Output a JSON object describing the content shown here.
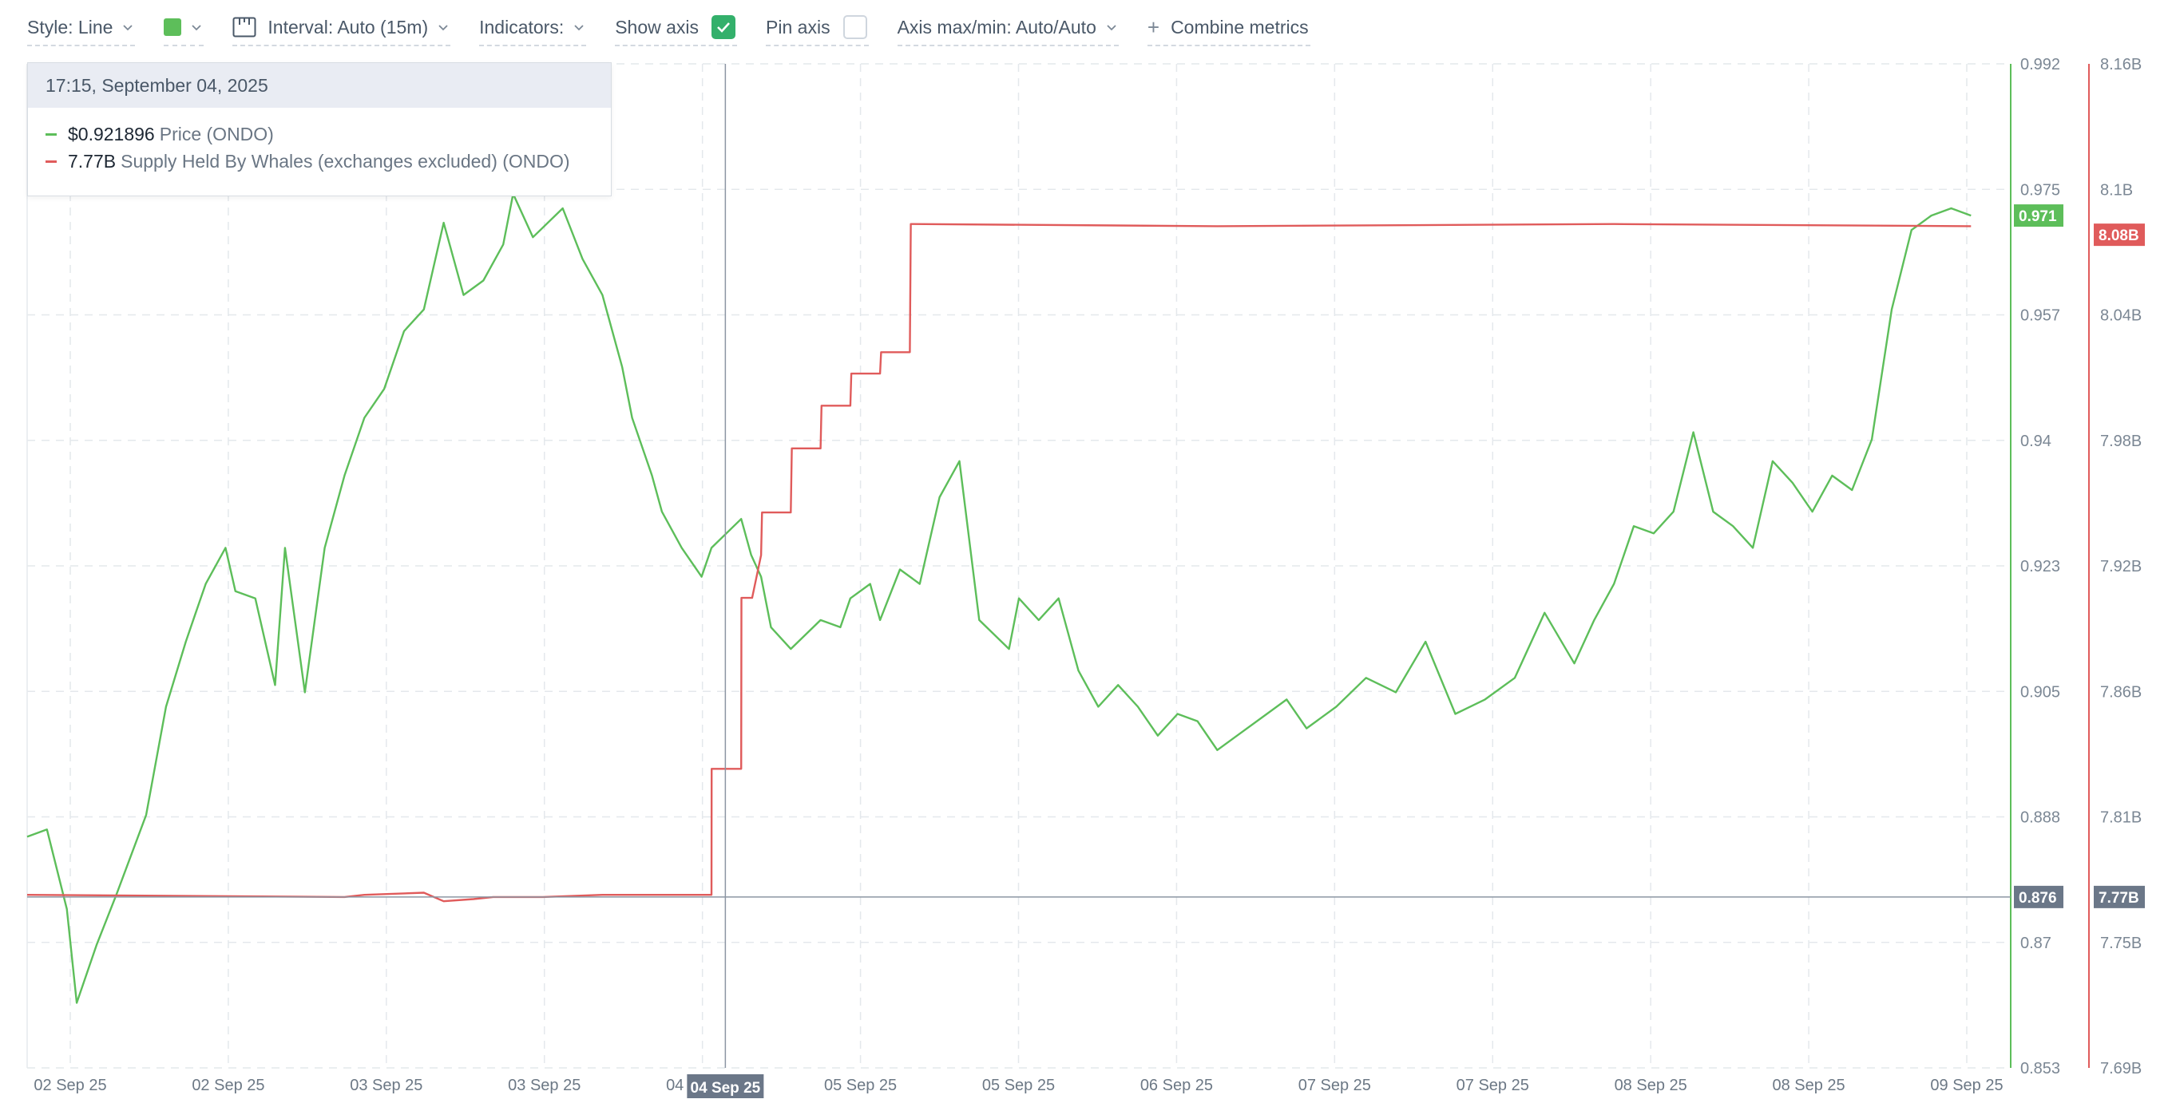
{
  "toolbar": {
    "style_label": "Style: Line",
    "color_value": "#5dbe5a",
    "interval_label": "Interval: Auto (15m)",
    "indicators_label": "Indicators:",
    "show_axis_label": "Show axis",
    "show_axis_checked": true,
    "pin_axis_label": "Pin axis",
    "pin_axis_checked": false,
    "axis_maxmin_label": "Axis max/min: Auto/Auto",
    "combine_label": "Combine metrics"
  },
  "tooltip": {
    "timestamp": "17:15, September 04, 2025",
    "rows": [
      {
        "value": "$0.921896",
        "name": "Price (ONDO)",
        "color": "#5dbe5a"
      },
      {
        "value": "7.77B",
        "name": "Supply Held By Whales (exchanges excluded) (ONDO)",
        "color": "#e05b5b"
      }
    ]
  },
  "chart_data": {
    "type": "line",
    "x_ticks": [
      "02 Sep 25",
      "02 Sep 25",
      "03 Sep 25",
      "03 Sep 25",
      "04 Sep 25",
      "05 Sep 25",
      "05 Sep 25",
      "06 Sep 25",
      "07 Sep 25",
      "07 Sep 25",
      "08 Sep 25",
      "08 Sep 25",
      "09 Sep 25"
    ],
    "crosshair_x_label": "04 Sep 25",
    "price_axis": {
      "ticks": [
        "0.992",
        "0.975",
        "0.957",
        "0.94",
        "0.923",
        "0.905",
        "0.888",
        "0.87",
        "0.853"
      ],
      "range": [
        0.853,
        0.992
      ],
      "current_badge": "0.971",
      "crosshair_badge": "0.876"
    },
    "supply_axis": {
      "ticks": [
        "8.16B",
        "8.1B",
        "8.04B",
        "7.98B",
        "7.92B",
        "7.86B",
        "7.81B",
        "7.75B",
        "7.69B"
      ],
      "range": [
        7.69,
        8.16
      ],
      "current_badge": "8.08B",
      "crosshair_badge": "7.77B"
    },
    "grid": true,
    "series": [
      {
        "name": "Price (ONDO)",
        "color": "#5dbe5a",
        "x": [
          0,
          0.01,
          0.02,
          0.025,
          0.035,
          0.045,
          0.06,
          0.07,
          0.08,
          0.085,
          0.09,
          0.1,
          0.105,
          0.115,
          0.125,
          0.13,
          0.14,
          0.15,
          0.16,
          0.17,
          0.18,
          0.19,
          0.2,
          0.21,
          0.22,
          0.23,
          0.24,
          0.245,
          0.255,
          0.27,
          0.28,
          0.29,
          0.3,
          0.305,
          0.315,
          0.32,
          0.33,
          0.34,
          0.345,
          0.36,
          0.365,
          0.37,
          0.375,
          0.385,
          0.4,
          0.41,
          0.415,
          0.425,
          0.43,
          0.44,
          0.45,
          0.46,
          0.47,
          0.48,
          0.495,
          0.5,
          0.51,
          0.52,
          0.53,
          0.54,
          0.55,
          0.56,
          0.57,
          0.58,
          0.59,
          0.6,
          0.61,
          0.625,
          0.635,
          0.645,
          0.66,
          0.675,
          0.69,
          0.705,
          0.72,
          0.735,
          0.75,
          0.765,
          0.78,
          0.79,
          0.8,
          0.81,
          0.82,
          0.83,
          0.84,
          0.85,
          0.86,
          0.87,
          0.88,
          0.89,
          0.9,
          0.91,
          0.92,
          0.93,
          0.94,
          0.95,
          0.96,
          0.97,
          0.98
        ],
        "values": [
          0.885,
          0.886,
          0.875,
          0.862,
          0.87,
          0.877,
          0.888,
          0.903,
          0.912,
          0.916,
          0.92,
          0.925,
          0.919,
          0.918,
          0.906,
          0.925,
          0.905,
          0.925,
          0.935,
          0.943,
          0.947,
          0.955,
          0.958,
          0.97,
          0.96,
          0.962,
          0.967,
          0.974,
          0.968,
          0.972,
          0.965,
          0.96,
          0.95,
          0.943,
          0.935,
          0.93,
          0.925,
          0.921,
          0.925,
          0.929,
          0.924,
          0.921,
          0.914,
          0.911,
          0.915,
          0.914,
          0.918,
          0.92,
          0.915,
          0.922,
          0.92,
          0.932,
          0.937,
          0.915,
          0.911,
          0.918,
          0.915,
          0.918,
          0.908,
          0.903,
          0.906,
          0.903,
          0.899,
          0.902,
          0.901,
          0.897,
          0.899,
          0.902,
          0.904,
          0.9,
          0.903,
          0.907,
          0.905,
          0.912,
          0.902,
          0.904,
          0.907,
          0.916,
          0.909,
          0.915,
          0.92,
          0.928,
          0.927,
          0.93,
          0.941,
          0.93,
          0.928,
          0.925,
          0.937,
          0.934,
          0.93,
          0.935,
          0.933,
          0.94,
          0.958,
          0.969,
          0.971,
          0.972,
          0.971
        ]
      },
      {
        "name": "Supply Held By Whales (exchanges excluded) (ONDO)",
        "color": "#e05b5b",
        "x": [
          0,
          0.16,
          0.17,
          0.2,
          0.21,
          0.225,
          0.235,
          0.26,
          0.29,
          0.345,
          0.3451,
          0.36,
          0.3601,
          0.3655,
          0.37,
          0.3705,
          0.385,
          0.3855,
          0.4,
          0.4005,
          0.415,
          0.4155,
          0.43,
          0.4305,
          0.445,
          0.4455,
          0.6,
          0.8,
          0.98
        ],
        "values": [
          7.771,
          7.77,
          7.771,
          7.772,
          7.768,
          7.769,
          7.77,
          7.77,
          7.771,
          7.771,
          7.83,
          7.83,
          7.91,
          7.91,
          7.93,
          7.95,
          7.95,
          7.98,
          7.98,
          8.0,
          8.0,
          8.015,
          8.015,
          8.025,
          8.025,
          8.085,
          8.084,
          8.085,
          8.084
        ]
      }
    ],
    "crosshair_x": 0.352
  },
  "colors": {
    "price": "#5dbe5a",
    "supply": "#e05b5b",
    "crosshair_badge": "#6b7788",
    "grid": "#e4e8ec"
  }
}
